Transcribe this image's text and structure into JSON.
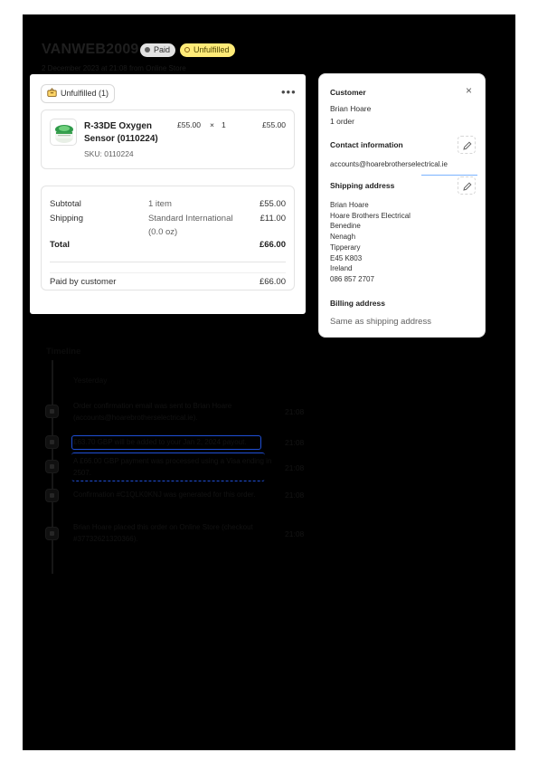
{
  "order": {
    "number": "VANWEB2009",
    "paid_badge": "Paid",
    "fulfillment_badge": "Unfulfilled",
    "meta": "2 December 2023 at 21:08 from Online Store"
  },
  "fulfillment": {
    "status_label": "Unfulfilled (1)",
    "more_label": "•••",
    "item": {
      "name": "R-33DE Oxygen Sensor (0110224)",
      "sku": "SKU: 0110224",
      "unit_price": "£55.00",
      "times": "×",
      "quantity": "1",
      "total": "£55.00"
    }
  },
  "summary": {
    "subtotal_label": "Subtotal",
    "subtotal_detail": "1 item",
    "subtotal_value": "£55.00",
    "shipping_label": "Shipping",
    "shipping_detail": "Standard International (0.0 oz)",
    "shipping_value": "£11.00",
    "total_label": "Total",
    "total_value": "£66.00",
    "paid_label": "Paid by customer",
    "paid_value": "£66.00"
  },
  "customer": {
    "heading": "Customer",
    "close_label": "×",
    "name": "Brian Hoare",
    "orders": "1 order",
    "contact_heading": "Contact information",
    "email": "accounts@hoarebrotherselectrical.ie",
    "shipping_heading": "Shipping address",
    "address_lines": [
      "Brian Hoare",
      "Hoare Brothers Electrical",
      "Benedine",
      "Nenagh",
      "Tipperary",
      "E45 K803",
      "Ireland",
      "086 857 2707"
    ],
    "billing_heading": "Billing address",
    "billing_value": "Same as shipping address"
  },
  "timeline": {
    "title": "Timeline",
    "day": "Yesterday",
    "events": [
      {
        "text": "Order confirmation email was sent to Brian Hoare (accounts@hoarebrotherselectrical.ie).",
        "time": "21:08"
      },
      {
        "text": "£63.70 GBP will be added to your Jan 2, 2024 payout.",
        "time": "21:08"
      },
      {
        "text": "A £66.00 GBP payment was processed using a Visa ending in 2507.",
        "time": "21:08"
      },
      {
        "text": "Confirmation #C1QLK0KNJ was generated for this order.",
        "time": "21:08"
      },
      {
        "text": "Brian Hoare placed this order on Online Store (checkout #37732621320366).",
        "time": "21:08"
      }
    ]
  },
  "colors": {
    "background": "#000000",
    "card": "#ffffff",
    "unfulfilled_badge": "#ffeb78",
    "paid_badge": "#e3e3e3",
    "focus_ring": "#1f4fd6"
  },
  "icons": [
    "package-icon",
    "more-icon",
    "close-icon",
    "pencil-icon",
    "sensor-product-thumbnail"
  ]
}
